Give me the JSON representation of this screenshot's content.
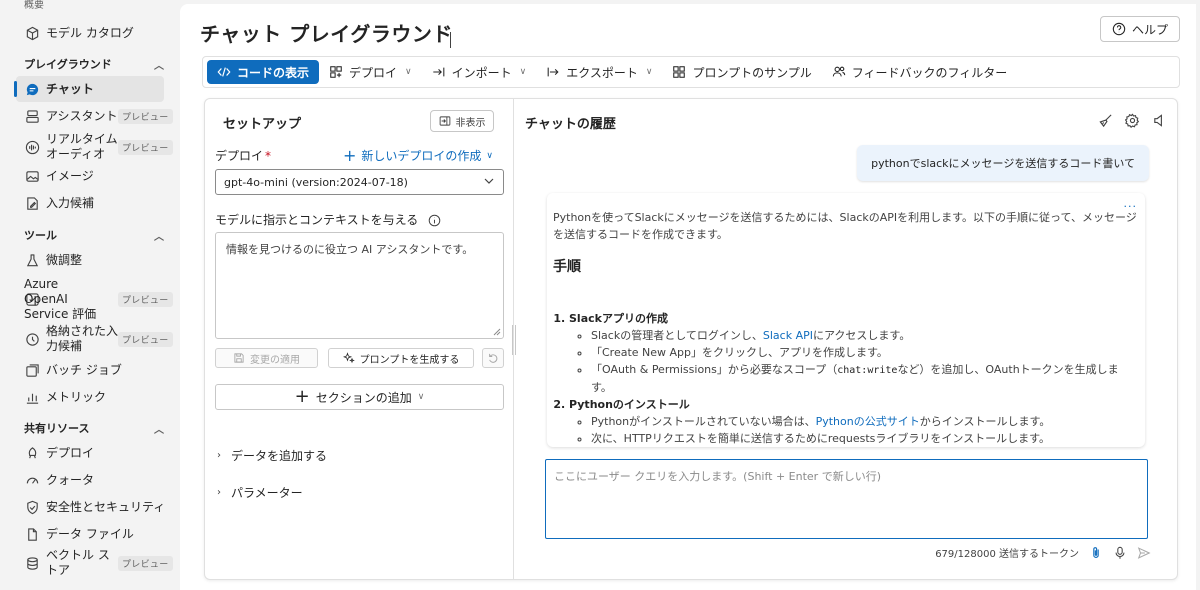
{
  "sidebar": {
    "clipped_label": "概要",
    "items_top": [
      {
        "label": "モデル カタログ",
        "icon": "cube-icon"
      }
    ],
    "sections": [
      {
        "title": "プレイグラウンド"
      },
      {
        "title": "ツール"
      },
      {
        "title": "共有リソース"
      }
    ],
    "playground_items": [
      {
        "label": "チャット",
        "badge": ""
      },
      {
        "label": "アシスタント",
        "badge": "プレビュー"
      },
      {
        "label": "リアルタイム",
        "label2": "オーディオ",
        "badge": "プレビュー"
      },
      {
        "label": "イメージ",
        "badge": ""
      },
      {
        "label": "入力候補",
        "badge": ""
      }
    ],
    "tool_items": [
      {
        "label": "微調整",
        "badge": ""
      },
      {
        "label": "Azure",
        "label2": "OpenAI",
        "label3": "Service 評価",
        "badge": "プレビュー"
      },
      {
        "label": "格納された入",
        "label2": "力候補",
        "badge": "プレビュー"
      },
      {
        "label": "バッチ ジョブ",
        "badge": ""
      },
      {
        "label": "メトリック",
        "badge": ""
      }
    ],
    "shared_items": [
      {
        "label": "デプロイ",
        "badge": ""
      },
      {
        "label": "クォータ",
        "badge": ""
      },
      {
        "label": "安全性とセキュリティ",
        "badge": ""
      },
      {
        "label": "データ ファイル",
        "badge": ""
      },
      {
        "label": "ベクトル ス",
        "label2": "トア",
        "badge": "プレビュー"
      }
    ]
  },
  "header": {
    "title": "チャット プレイグラウンド",
    "help_label": "ヘルプ"
  },
  "toolbar": {
    "view_code": "コードの表示",
    "deploy": "デプロイ",
    "import": "インポート",
    "export": "エクスポート",
    "prompt_samples": "プロンプトのサンプル",
    "feedback_filter": "フィードバックのフィルター"
  },
  "setup": {
    "title": "セットアップ",
    "hide_label": "非表示",
    "deploy_label": "デプロイ",
    "required_mark": "*",
    "new_deploy_label": "新しいデプロイの作成",
    "deployment_value": "gpt-4o-mini (version:2024-07-18)",
    "instructions_label": "モデルに指示とコンテキストを与える",
    "instructions_value": "情報を見つけるのに役立つ AI アシスタントです。",
    "apply_changes": "変更の適用",
    "generate_prompt": "プロンプトを生成する",
    "add_section": "セクションの追加",
    "add_data": "データを追加する",
    "parameters": "パラメーター"
  },
  "chat": {
    "title": "チャットの履歴",
    "user_message": "pythonでslackにメッセージを送信するコード書いて",
    "assistant": {
      "more": "...",
      "intro": "Pythonを使ってSlackにメッセージを送信するためには、SlackのAPIを利用します。以下の手順に従って、メッセージを送信するコードを作成できます。",
      "heading": "手順",
      "step1_title": "Slackアプリの作成",
      "step1_b1_pre": "Slackの管理者としてログインし、",
      "step1_b1_link": "Slack API",
      "step1_b1_post": "にアクセスします。",
      "step1_b2": "「Create New App」をクリックし、アプリを作成します。",
      "step1_b3_pre": "「OAuth & Permissions」から必要なスコープ（",
      "step1_b3_code": "chat:write",
      "step1_b3_post": "など）を追加し、OAuthトークンを生成します。",
      "step2_title": "Pythonのインストール",
      "step2_b1_pre": "Pythonがインストールされていない場合は、",
      "step2_b1_link": "Pythonの公式サイト",
      "step2_b1_post": "からインストールします。",
      "step2_b2": "次に、HTTPリクエストを簡単に送信するためにrequestsライブラリをインストールします。"
    },
    "input_placeholder": "ここにユーザー クエリを入力します。(Shift + Enter で新しい行)",
    "token_count": "679/128000 送信するトークン"
  },
  "colors": {
    "accent": "#0f6cbd",
    "required": "#c50f1f"
  }
}
